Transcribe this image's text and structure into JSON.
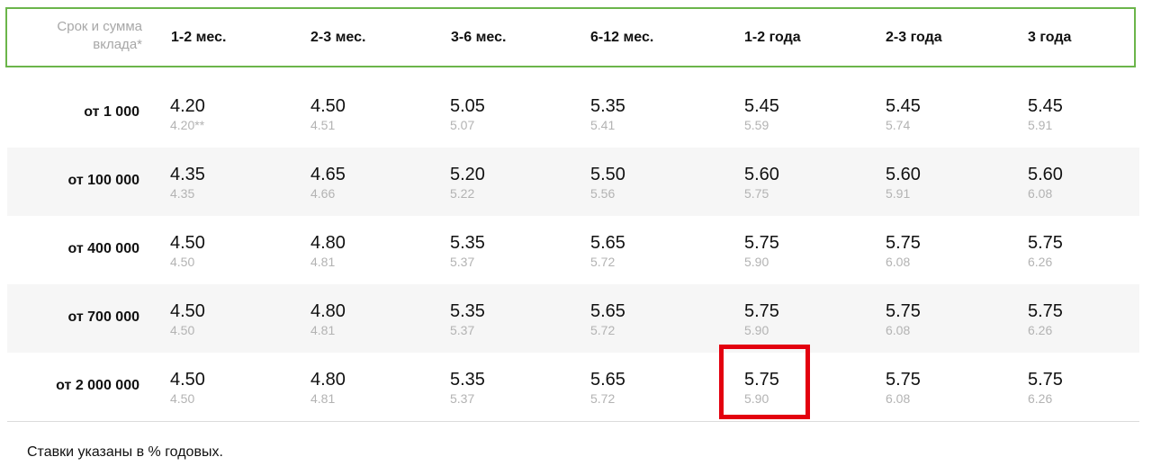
{
  "table": {
    "corner_label_line1": "Срок и сумма",
    "corner_label_line2": "вклада*",
    "columns": [
      "1-2 мес.",
      "2-3 мес.",
      "3-6 мес.",
      "6-12 мес.",
      "1-2 года",
      "2-3 года",
      "3 года"
    ],
    "rows": [
      {
        "label": "от 1 000",
        "rates": [
          "4.20",
          "4.50",
          "5.05",
          "5.35",
          "5.45",
          "5.45",
          "5.45"
        ],
        "effective": [
          "4.20**",
          "4.51",
          "5.07",
          "5.41",
          "5.59",
          "5.74",
          "5.91"
        ]
      },
      {
        "label": "от 100 000",
        "rates": [
          "4.35",
          "4.65",
          "5.20",
          "5.50",
          "5.60",
          "5.60",
          "5.60"
        ],
        "effective": [
          "4.35",
          "4.66",
          "5.22",
          "5.56",
          "5.75",
          "5.91",
          "6.08"
        ]
      },
      {
        "label": "от 400 000",
        "rates": [
          "4.50",
          "4.80",
          "5.35",
          "5.65",
          "5.75",
          "5.75",
          "5.75"
        ],
        "effective": [
          "4.50",
          "4.81",
          "5.37",
          "5.72",
          "5.90",
          "6.08",
          "6.26"
        ]
      },
      {
        "label": "от 700 000",
        "rates": [
          "4.50",
          "4.80",
          "5.35",
          "5.65",
          "5.75",
          "5.75",
          "5.75"
        ],
        "effective": [
          "4.50",
          "4.81",
          "5.37",
          "5.72",
          "5.90",
          "6.08",
          "6.26"
        ]
      },
      {
        "label": "от 2 000 000",
        "rates": [
          "4.50",
          "4.80",
          "5.35",
          "5.65",
          "5.75",
          "5.75",
          "5.75"
        ],
        "effective": [
          "4.50",
          "4.81",
          "5.37",
          "5.72",
          "5.90",
          "6.08",
          "6.26"
        ]
      }
    ],
    "highlighted_cell": {
      "row": 4,
      "column": 4
    }
  },
  "footnote": "Ставки указаны в % годовых.",
  "colors": {
    "header_border": "#6bb54a",
    "highlight_border": "#e3000f",
    "shaded_row": "#f6f6f6",
    "muted_text": "#b3b3b3"
  }
}
